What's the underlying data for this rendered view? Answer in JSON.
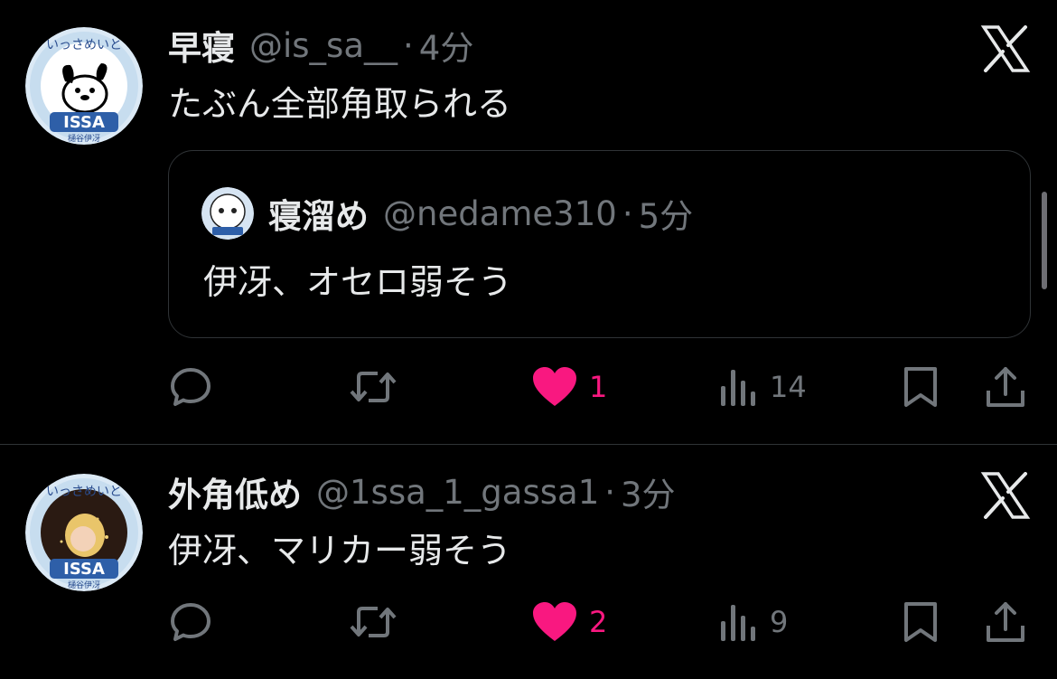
{
  "tweets": [
    {
      "author": {
        "name": "早寝",
        "handle": "@is_sa__",
        "time": "4分"
      },
      "avatar_text": {
        "top": "いっさめいと",
        "badge": "ISSA",
        "bottom": "樋谷伊冴"
      },
      "text": "たぶん全部角取られる",
      "quote": {
        "author": {
          "name": "寝溜め",
          "handle": "@nedame310",
          "time": "5分"
        },
        "text": "伊冴、オセロ弱そう"
      },
      "stats": {
        "likes": "1",
        "views": "14"
      }
    },
    {
      "author": {
        "name": "外角低め",
        "handle": "@1ssa_1_gassa1",
        "time": "3分"
      },
      "avatar_text": {
        "top": "いっさめいと",
        "badge": "ISSA",
        "bottom": "樋谷伊冴"
      },
      "text": "伊冴、マリカー弱そう",
      "stats": {
        "likes": "2",
        "views": "9"
      }
    }
  ],
  "separator": "·",
  "colors": {
    "background": "#000000",
    "text": "#e7e9ea",
    "muted": "#71767b",
    "like": "#f91880",
    "border": "#2f3336"
  },
  "icons": [
    "x-logo-icon",
    "reply-icon",
    "retweet-icon",
    "heart-icon",
    "views-icon",
    "bookmark-icon",
    "share-icon"
  ]
}
